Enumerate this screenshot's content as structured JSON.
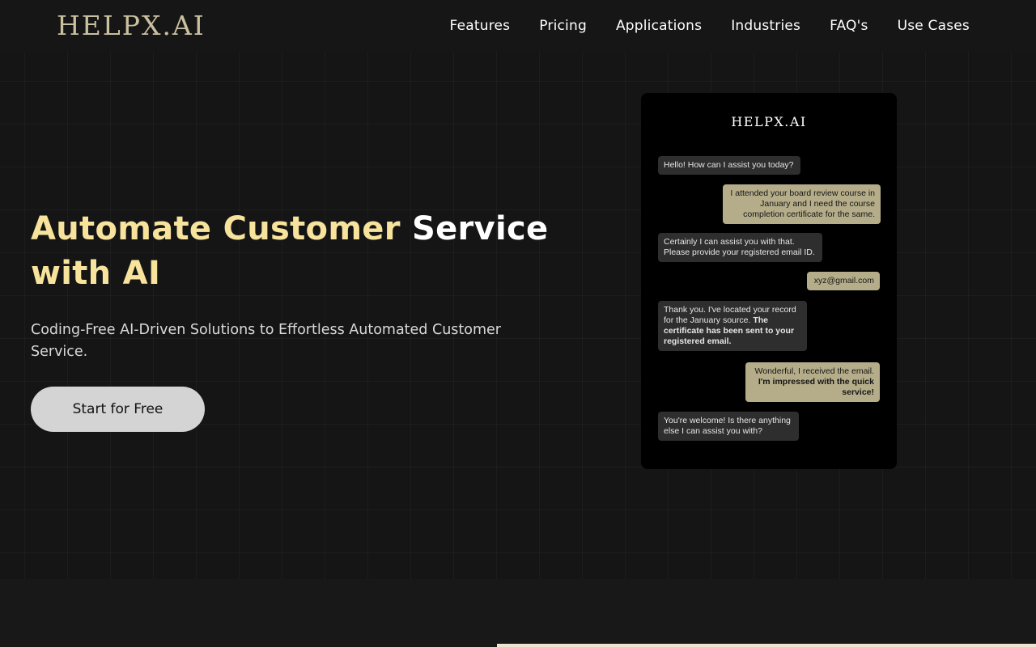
{
  "header": {
    "logo": "HELPX.AI",
    "nav": [
      "Features",
      "Pricing",
      "Applications",
      "Industries",
      "FAQ's",
      "Use Cases"
    ]
  },
  "hero": {
    "title_accent": "Automate Customer",
    "title_rest_line1": "Service",
    "title_line2": "with AI",
    "subtitle": "Coding-Free AI-Driven Solutions to Effortless Automated Customer Service.",
    "cta_label": "Start for Free"
  },
  "chat": {
    "logo": "HELPX.AI",
    "messages": [
      {
        "role": "bot",
        "text": "Hello! How can I assist you today?"
      },
      {
        "role": "user",
        "text": "I attended your board review course in January and I need the course completion certificate for the same."
      },
      {
        "role": "bot",
        "text": "Certainly I can assist you with that. Please provide your registered email ID."
      },
      {
        "role": "user",
        "text": "xyz@gmail.com"
      },
      {
        "role": "bot",
        "text": "Thank you. I've located your record for the January source.",
        "bold": "The certificate has been sent to your registered email."
      },
      {
        "role": "user",
        "text": "Wonderful, I received the email.",
        "bold": "I'm impressed with the quick service!"
      },
      {
        "role": "bot",
        "text": "You're welcome! Is there anything else I can assist you with?"
      }
    ]
  },
  "colors": {
    "accent": "#f7e39c",
    "logo": "#c9c0a0",
    "user_bubble": "#b5ad8a",
    "bot_bubble": "#2e2e2e"
  }
}
